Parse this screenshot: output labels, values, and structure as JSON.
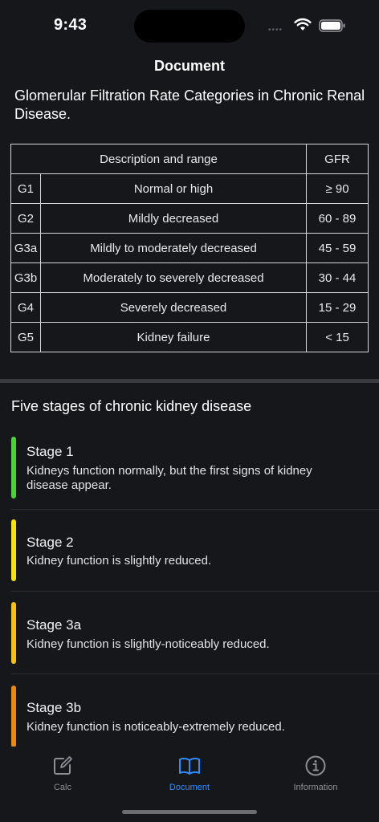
{
  "status": {
    "time": "9:43"
  },
  "nav": {
    "title": "Document"
  },
  "document": {
    "title": "Glomerular Filtration Rate Categories in Chronic Renal Disease."
  },
  "table": {
    "headers": {
      "desc": "Description and range",
      "gfr": "GFR"
    },
    "rows": [
      {
        "code": "G1",
        "desc": "Normal or high",
        "gfr": "≥ 90"
      },
      {
        "code": "G2",
        "desc": "Mildly decreased",
        "gfr": "60 - 89"
      },
      {
        "code": "G3a",
        "desc": "Mildly to moderately decreased",
        "gfr": "45 - 59"
      },
      {
        "code": "G3b",
        "desc": "Moderately to severely decreased",
        "gfr": "30 - 44"
      },
      {
        "code": "G4",
        "desc": "Severely decreased",
        "gfr": "15 - 29"
      },
      {
        "code": "G5",
        "desc": "Kidney failure",
        "gfr": "< 15"
      }
    ]
  },
  "stages_section": {
    "title": "Five stages of chronic kidney disease",
    "items": [
      {
        "title": "Stage 1",
        "desc": "Kidneys function normally, but the first signs of kidney disease appear.",
        "color": "#4cd137"
      },
      {
        "title": "Stage 2",
        "desc": "Kidney function is slightly reduced.",
        "color": "#f4e20c"
      },
      {
        "title": "Stage 3a",
        "desc": "Kidney function is slightly-noticeably reduced.",
        "color": "#f5c20f"
      },
      {
        "title": "Stage 3b",
        "desc": "Kidney function is noticeably-extremely reduced.",
        "color": "#e88a0e"
      }
    ]
  },
  "tabs": {
    "calc": {
      "label": "Calc",
      "icon": "edit-icon"
    },
    "document": {
      "label": "Document",
      "icon": "book-icon"
    },
    "information": {
      "label": "Information",
      "icon": "info-icon"
    },
    "active_color": "#2f8cff",
    "inactive_color": "#8e8e93"
  }
}
